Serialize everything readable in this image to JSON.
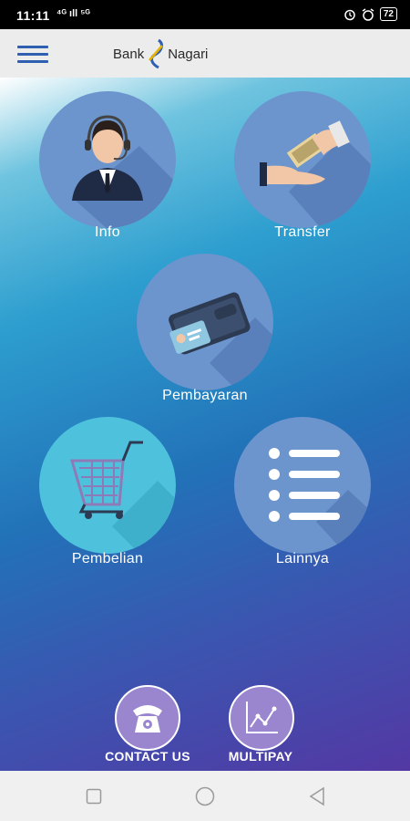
{
  "status_bar": {
    "time": "11:11",
    "signal": "⁴ᴳ ıll ⁵ᴳ",
    "battery": "72"
  },
  "header": {
    "logo_left": "Bank",
    "logo_right": "Nagari"
  },
  "tiles": [
    {
      "label": "Info",
      "icon": "customer-service-agent-icon"
    },
    {
      "label": "Transfer",
      "icon": "money-hand-transfer-icon"
    },
    {
      "label": "Pembayaran",
      "icon": "wallet-card-icon"
    },
    {
      "label": "Pembelian",
      "icon": "shopping-cart-icon"
    },
    {
      "label": "Lainnya",
      "icon": "list-icon"
    }
  ],
  "bottom": {
    "contact_label": "CONTACT US",
    "multipay_label": "MULTIPAY"
  },
  "colors": {
    "tile_blue": "#6c94cd",
    "tile_teal": "#4ec2dd",
    "header_bg": "#ececec",
    "accent": "#2f5fb0"
  }
}
